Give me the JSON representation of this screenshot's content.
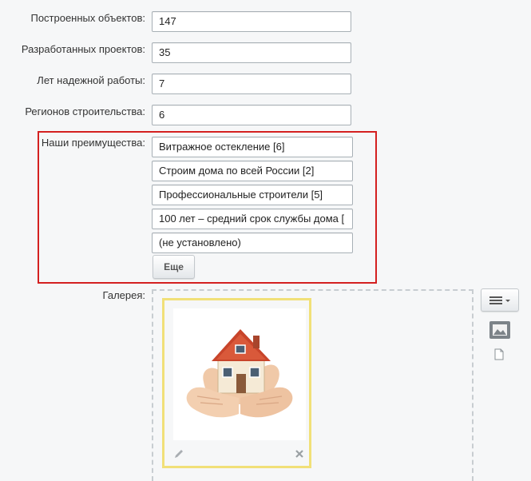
{
  "fields": [
    {
      "label": "Построенных объектов:",
      "value": "147"
    },
    {
      "label": "Разработанных проектов:",
      "value": "35"
    },
    {
      "label": "Лет надежной работы:",
      "value": "7"
    },
    {
      "label": "Регионов строительства:",
      "value": "6"
    }
  ],
  "advantages": {
    "label": "Наши преимущества:",
    "items": [
      "Витражное остекление [6]",
      "Строим дома по всей России [2]",
      "Профессиональные строители [5]",
      "100 лет – средний срок службы дома [",
      "(не установлено)"
    ],
    "more_button": "Еще"
  },
  "gallery": {
    "label": "Галерея:",
    "icons": {
      "edit": "pencil-icon",
      "remove": "close-icon",
      "view_menu": "hamburger-icon",
      "image_mode": "image-icon",
      "file_mode": "file-icon"
    }
  },
  "colors": {
    "highlight_border": "#d42020",
    "thumb_border": "#f1e078",
    "page_bg": "#f6f7f8"
  }
}
